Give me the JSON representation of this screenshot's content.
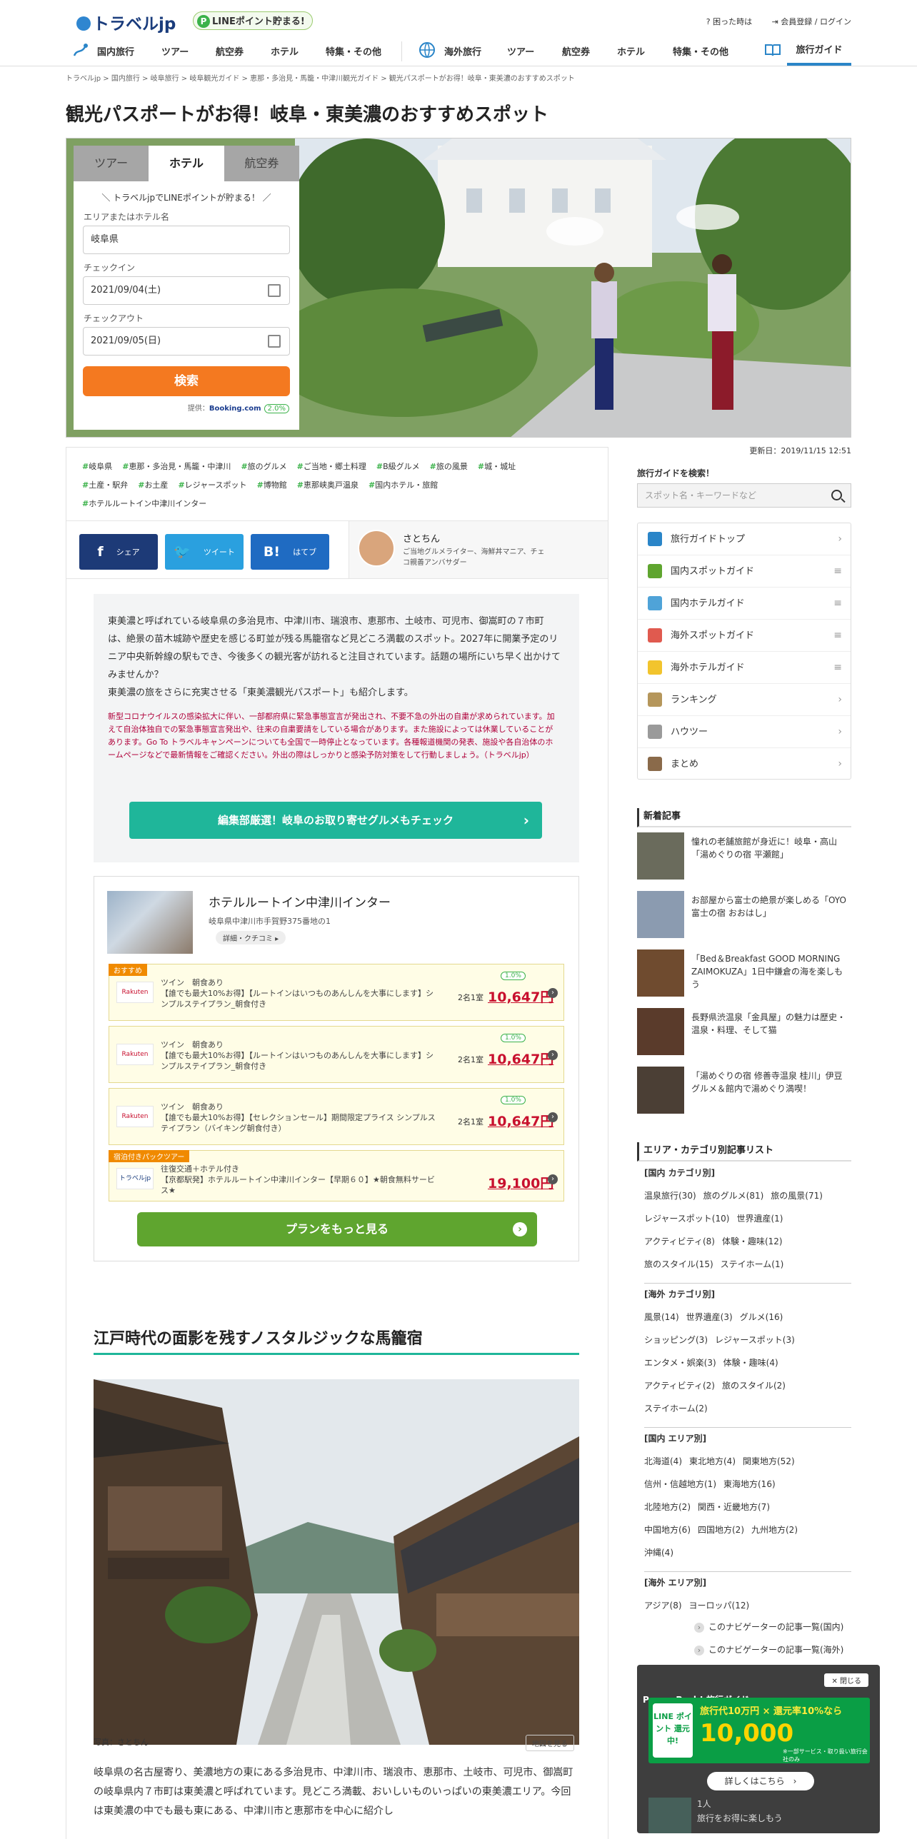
{
  "header": {
    "logo": "トラベルjp",
    "line_badge": "LINEポイント貯まる!",
    "help": "困った時は",
    "login": "会員登録 / ログイン",
    "nav_domestic": [
      "国内旅行",
      "ツアー",
      "航空券",
      "ホテル",
      "特集・その他"
    ],
    "nav_overseas": [
      "海外旅行",
      "ツアー",
      "航空券",
      "ホテル",
      "特集・その他"
    ],
    "guide": "旅行ガイド"
  },
  "breadcrumb": "トラベルjp  >  国内旅行  >  岐阜旅行  >  岐阜観光ガイド  >  恵那・多治見・馬籠・中津川観光ガイド  >  観光パスポートがお得！岐阜・東美濃のおすすめスポット",
  "title": "観光パスポートがお得！岐阜・東美濃のおすすめスポット",
  "booking": {
    "tabs": [
      "ツアー",
      "ホテル",
      "航空券"
    ],
    "promo": "＼ トラベルjpでLINEポイントが貯まる！ ／",
    "area_label": "エリアまたはホテル名",
    "area_value": "岐阜県",
    "checkin_label": "チェックイン",
    "checkin_value": "2021/09/04(土)",
    "checkout_label": "チェックアウト",
    "checkout_value": "2021/09/05(日)",
    "search": "検索",
    "provider_label": "提供：",
    "provider": "Booking.com",
    "rate": "2.0%"
  },
  "updated": "更新日：2019/11/15 12:51",
  "tags": [
    "岐阜県",
    "恵那・多治見・馬籠・中津川",
    "旅のグルメ",
    "ご当地・郷土料理",
    "B級グルメ",
    "旅の風景",
    "城・城址",
    "土産・駅弁",
    "お土産",
    "レジャースポット",
    "博物館",
    "恵那峡奥戸温泉",
    "国内ホテル・旅館",
    "ホテルルートイン中津川インター"
  ],
  "share": {
    "facebook": "シェア",
    "twitter": "ツイート",
    "hatena": "はてブ"
  },
  "author": {
    "name": "さとちん",
    "desc": "ご当地グルメライター、海鮮丼マニア、チェコ親善アンバサダー"
  },
  "intro": {
    "text": "東美濃と呼ばれている岐阜県の多治見市、中津川市、瑞浪市、恵那市、土岐市、可児市、御嵩町の７市町は、絶景の苗木城跡や歴史を感じる町並が残る馬籠宿など見どころ満載のスポット。2027年に開業予定のリニア中央新幹線の駅もでき、今後多くの観光客が訪れると注目されています。話題の場所にいち早く出かけてみませんか？",
    "text2": "東美濃の旅をさらに充実させる「東美濃観光パスポート」も紹介します。",
    "covid": "新型コロナウイルスの感染拡大に伴い、一部都府県に緊急事態宣言が発出され、不要不急の外出の自粛が求められています。加えて自治体独自での緊急事態宣言発出や、往来の自粛要請をしている場合があります。また施設によっては休業していることがあります。Go To トラベルキャンペーンについても全国で一時停止となっています。各種報道機関の発表、施設や各自治体のホームページなどで最新情報をご確認ください。外出の際はしっかりと感染予防対策をして行動しましょう。（トラベルjp）",
    "button": "編集部厳選！岐阜のお取り寄せグルメもチェック"
  },
  "hotel": {
    "name": "ホテルルートイン中津川インター",
    "address": "岐阜県中津川市手賀野375番地の1",
    "detail": "詳細・クチコミ ▸",
    "offers": [
      {
        "tag": "おすすめ",
        "text": "ツイン　朝食あり\n【誰でも最大10%お得】【ルートインはいつものあんしんを大事にします】シンプルステイプラン_朝食付き",
        "room": "2名1室",
        "price": "10,647円",
        "badge": "1.0%",
        "logo": "Rakuten"
      },
      {
        "tag": "",
        "text": "ツイン　朝食あり\n【誰でも最大10%お得】【ルートインはいつものあんしんを大事にします】シンプルステイプラン_朝食付き",
        "room": "2名1室",
        "price": "10,647円",
        "badge": "1.0%",
        "logo": "Rakuten"
      },
      {
        "tag": "",
        "text": "ツイン　朝食あり\n【誰でも最大10%お得】【セレクションセール】期間限定プライス シンプルステイプラン（バイキング朝食付き）",
        "room": "2名1室",
        "price": "10,647円",
        "badge": "1.0%",
        "logo": "Rakuten"
      },
      {
        "tag": "宿泊付きパックツアー",
        "text": "往復交通＋ホテル付き\n【京都駅発】ホテルルートイン中津川インター【早期６０】★朝食無料サービス★",
        "room": "",
        "price": "19,100円",
        "badge": "",
        "logo": "トラベルjp"
      }
    ],
    "more": "プランをもっと見る"
  },
  "section": {
    "heading": "江戸時代の面影を残すノスタルジックな馬籠宿",
    "credit": "写真：さとちん",
    "map": "地図を見る",
    "body": "岐阜県の名古屋寄り、美濃地方の東にある多治見市、中津川市、瑞浪市、恵那市、土岐市、可児市、御嵩町の岐阜県内７市町は東美濃と呼ばれています。見どころ満載、おいしいものいっぱいの東美濃エリア。今回は東美濃の中でも最も東にある、中津川市と恵那市を中心に紹介し"
  },
  "sidebar": {
    "search_label": "旅行ガイドを検索！",
    "search_placeholder": "スポット名・キーワードなど",
    "menu": [
      "旅行ガイドトップ",
      "国内スポットガイド",
      "国内ホテルガイド",
      "海外スポットガイド",
      "海外ホテルガイド",
      "ランキング",
      "ハウツー",
      "まとめ"
    ],
    "news_title": "新着記事",
    "news": [
      "憧れの老舗旅館が身近に！岐阜・高山「湯めぐりの宿 平瀬館」",
      "お部屋から富士の絶景が楽しめる「OYO 富士の宿 おおはし」",
      "「Bed＆Breakfast GOOD MORNING ZAIMOKUZA」1日中鎌倉の海を楽しもう",
      "長野県渋温泉「金具屋」の魅力は歴史・温泉・料理、そして猫",
      "「湯めぐりの宿 修善寺温泉 桂川」伊豆グルメ＆館内で湯めぐり満喫！"
    ],
    "cat_title": "エリア・カテゴリ別記事リスト",
    "dom_cat_title": "[国内 カテゴリ別]",
    "dom_cat": [
      "温泉旅行(30)",
      "旅のグルメ(81)",
      "旅の風景(71)",
      "レジャースポット(10)",
      "世界遺産(1)",
      "アクティビティ(8)",
      "体験・趣味(12)",
      "旅のスタイル(15)",
      "ステイホーム(1)"
    ],
    "ovs_cat_title": "[海外 カテゴリ別]",
    "ovs_cat": [
      "風景(14)",
      "世界遺産(3)",
      "グルメ(16)",
      "ショッピング(3)",
      "レジャースポット(3)",
      "エンタメ・娯楽(3)",
      "体験・趣味(4)",
      "アクティビティ(2)",
      "旅のスタイル(2)",
      "ステイホーム(2)"
    ],
    "dom_area_title": "[国内 エリア別]",
    "dom_area": [
      "北海道(4)",
      "東北地方(4)",
      "関東地方(52)",
      "信州・信越地方(1)",
      "東海地方(16)",
      "北陸地方(2)",
      "関西・近畿地方(7)",
      "中国地方(6)",
      "四国地方(2)",
      "九州地方(2)",
      "沖縄(4)"
    ],
    "ovs_area_title": "[海外 エリア別]",
    "ovs_area": [
      "アジア(8)",
      "ヨーロッパ(12)"
    ],
    "link_dom": "このナビゲーターの記事一覧(国内)",
    "link_ovs": "このナビゲーターの記事一覧(海外)"
  },
  "popup": {
    "title": "Power Push! 旅行ガイド",
    "close": "閉じる",
    "line": "LINE ポイント 還元中!",
    "line1": "旅行代10万円 × 還元率10%なら",
    "line2": "10,000",
    "small": "※一部サービス・取り扱い旅行会社のみ",
    "more": "詳しくはこちら",
    "under1": "1人",
    "under2": "旅行をお得に楽しもう"
  }
}
